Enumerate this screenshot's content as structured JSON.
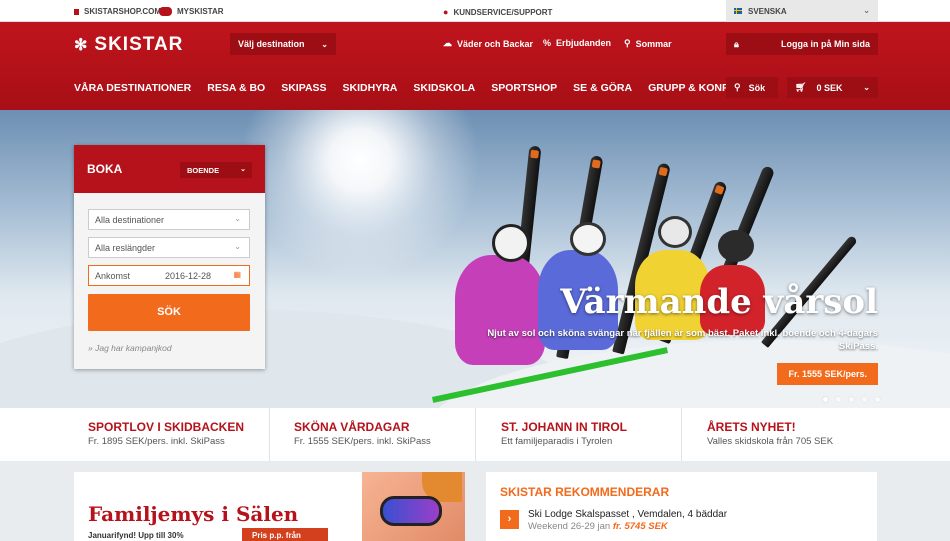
{
  "topbar": {
    "skistarshop": "SKISTARSHOP.COM",
    "myskistar": "MYSKISTAR",
    "kundservice": "KUNDSERVICE/SUPPORT",
    "language": "SVENSKA"
  },
  "header": {
    "logo": "SKISTAR",
    "destination_select": "Välj destination",
    "weather_link": "Väder och Backar",
    "offers_link": "Erbjudanden",
    "summer_link": "Sommar",
    "login_button": "Logga in på Min sida",
    "search_button": "Sök",
    "cart_amount": "0 SEK"
  },
  "nav": {
    "items": [
      "VÅRA DESTINATIONER",
      "RESA & BO",
      "SKIPASS",
      "SKIDHYRA",
      "SKIDSKOLA",
      "SPORTSHOP",
      "SE & GÖRA",
      "GRUPP & KONFERENS"
    ]
  },
  "booking": {
    "title": "BOKA",
    "type_select": "BOENDE",
    "destination_select": "Alla destinationer",
    "length_select": "Alla reslängder",
    "arrival_label": "Ankomst",
    "arrival_date": "2016-12-28",
    "search_button": "SÖK",
    "campaign_link": "» Jag har kampanjkod"
  },
  "hero": {
    "title": "Värmande vårsol",
    "subtitle": "Njut av sol och sköna svängar när fjällen är som bäst. Paket inkl. boende och 4-dagars SkiPass.",
    "price_button": "Fr. 1555 SEK/pers.",
    "slides": 5,
    "active_slide": 1
  },
  "promos": [
    {
      "title": "SPORTLOV I SKIDBACKEN",
      "text": "Fr. 1895 SEK/pers. inkl. SkiPass"
    },
    {
      "title": "SKÖNA VÅRDAGAR",
      "text": "Fr. 1555 SEK/pers. inkl. SkiPass"
    },
    {
      "title": "ST. JOHANN IN TIROL",
      "text": "Ett familjeparadis i Tyrolen"
    },
    {
      "title": "ÅRETS NYHET!",
      "text": "Valles skidskola från 705 SEK"
    }
  ],
  "family_card": {
    "title": "Familjemys i Sälen",
    "subtitle": "Januarifynd! Upp till 30%",
    "price_badge": "Pris p.p. från"
  },
  "recommend": {
    "title": "SKISTAR REKOMMENDERAR",
    "item_title": "Ski Lodge Skalspasset , Vemdalen, 4 bäddar",
    "item_dates": "Weekend 26-29 jan",
    "item_price": "fr. 5745 SEK"
  },
  "colors": {
    "brand_red": "#b5121b",
    "accent_orange": "#f26a1b"
  }
}
